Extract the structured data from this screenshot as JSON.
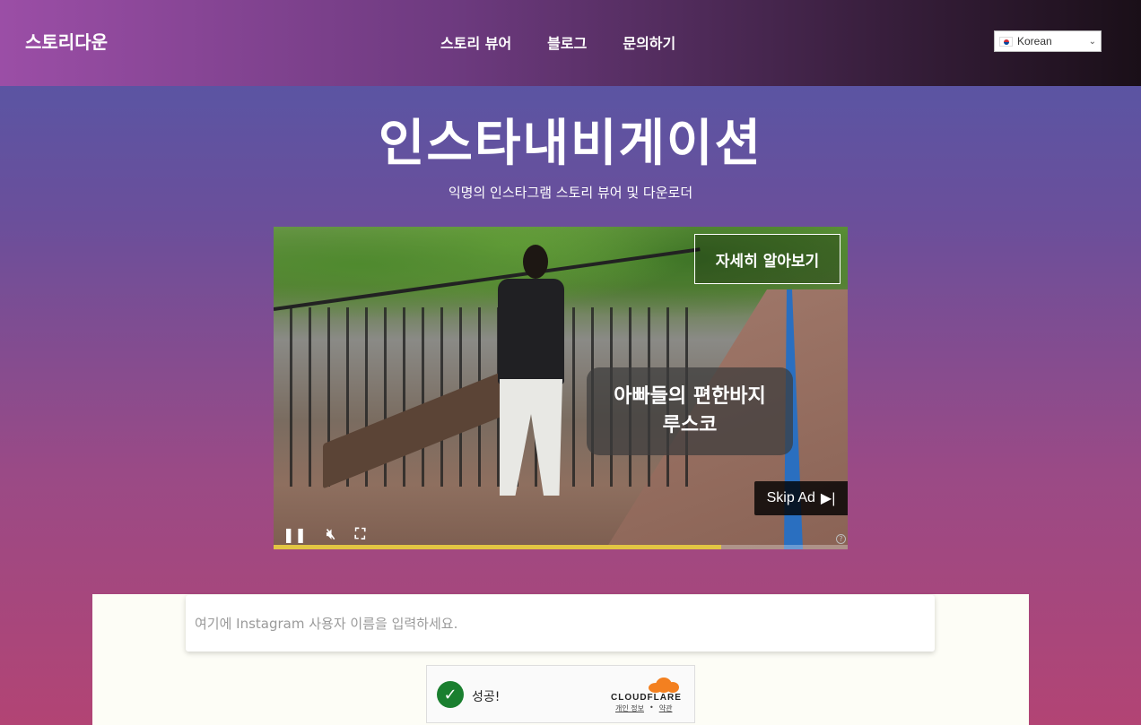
{
  "header": {
    "logo": "스토리다운",
    "nav": [
      "스토리 뷰어",
      "블로그",
      "문의하기"
    ],
    "language": "Korean"
  },
  "hero": {
    "title": "인스타내비게이션",
    "subtitle": "익명의 인스타그램 스토리 뷰어 및 다운로더"
  },
  "video": {
    "learn_more": "자세히 알아보기",
    "caption_line1": "아빠들의 편한바지",
    "caption_line2": "루스코",
    "skip_label": "Skip Ad",
    "progress": 0.78,
    "help_icon": "?"
  },
  "search": {
    "placeholder": "여기에 Instagram 사용자 이름을 입력하세요."
  },
  "captcha": {
    "status": "성공!",
    "brand": "CLOUDFLARE",
    "privacy_link": "개인 정보",
    "separator": "•",
    "terms_link": "약관"
  },
  "colors": {
    "cloudflare_orange": "#f38020",
    "progress_yellow": "#e2c543",
    "success_green": "#1a7f2f"
  }
}
